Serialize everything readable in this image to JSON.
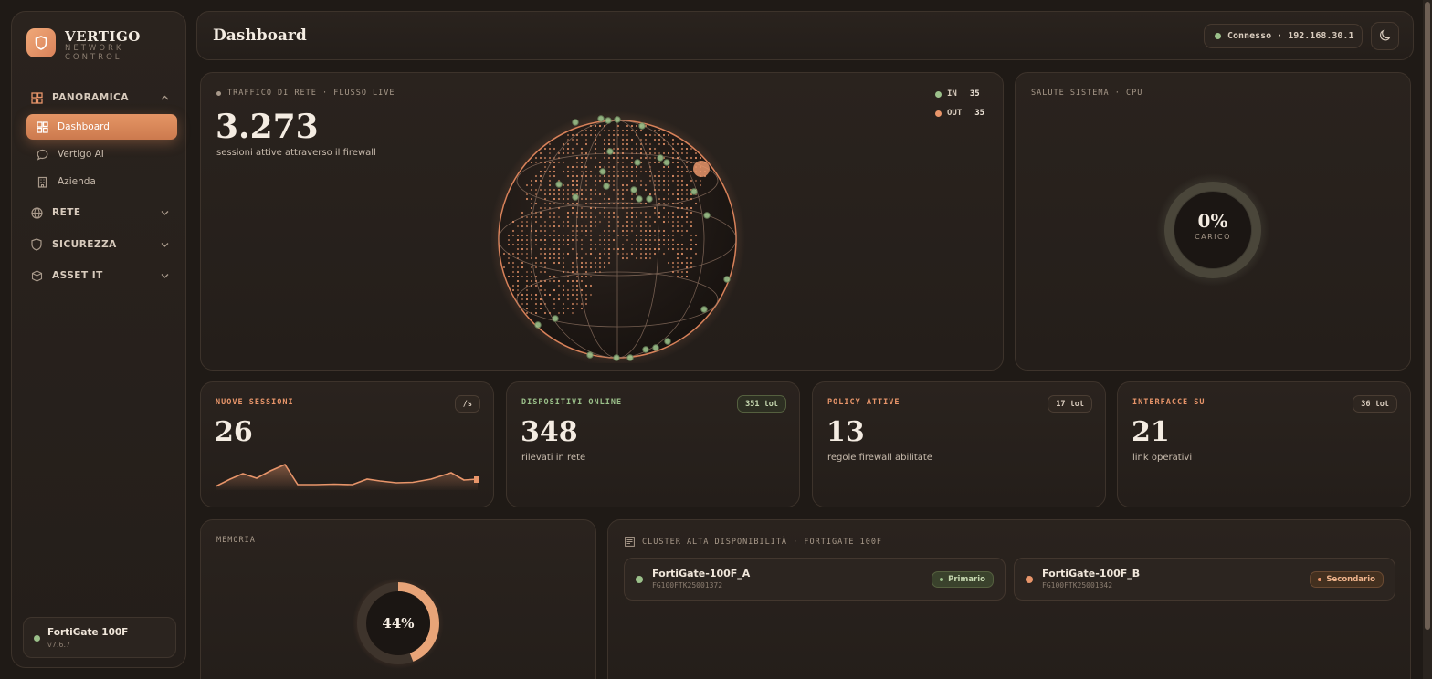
{
  "brand": {
    "name": "VERTIGO",
    "sub": "NETWORK CONTROL"
  },
  "sidebar": {
    "sections": [
      {
        "label": "PANORAMICA",
        "icon": "grid-icon",
        "expanded": true
      },
      {
        "label": "RETE",
        "icon": "globe-icon",
        "expanded": false
      },
      {
        "label": "SICUREZZA",
        "icon": "shield-icon",
        "expanded": false
      },
      {
        "label": "ASSET IT",
        "icon": "box-icon",
        "expanded": false
      }
    ],
    "items": [
      {
        "label": "Dashboard",
        "icon": "dashboard-icon",
        "active": true
      },
      {
        "label": "Vertigo AI",
        "icon": "chat-icon",
        "active": false
      },
      {
        "label": "Azienda",
        "icon": "building-icon",
        "active": false
      }
    ],
    "device": {
      "name": "FortiGate 100F",
      "version": "v7.6.7",
      "status_color": "#9bc08a"
    }
  },
  "header": {
    "title": "Dashboard",
    "connection": "Connesso · 192.168.30.1",
    "theme_icon": "moon-icon"
  },
  "traffic": {
    "label": "TRAFFICO DI RETE · FLUSSO LIVE",
    "value": "3.273",
    "desc": "sessioni attive attraverso il firewall",
    "legend": [
      {
        "label": "IN",
        "value": "35",
        "color": "#9bc08a"
      },
      {
        "label": "OUT",
        "value": "35",
        "color": "#e8956a"
      }
    ]
  },
  "cpu": {
    "label": "SALUTE SISTEMA · CPU",
    "value": "0%",
    "sublabel": "CARICO",
    "load_fraction": 0
  },
  "stats": [
    {
      "title": "NUOVE SESSIONI",
      "badge": "/s",
      "value": "26",
      "desc": "",
      "color": "#e8956a"
    },
    {
      "title": "DISPOSITIVI ONLINE",
      "badge": "351 tot",
      "value": "348",
      "desc": "rilevati in rete",
      "color": "#9bc08a"
    },
    {
      "title": "POLICY ATTIVE",
      "badge": "17 tot",
      "value": "13",
      "desc": "regole firewall abilitate",
      "color": "#e8956a"
    },
    {
      "title": "INTERFACCE SU",
      "badge": "36 tot",
      "value": "21",
      "desc": "link operativi",
      "color": "#e8956a"
    }
  ],
  "memory": {
    "label": "MEMORIA",
    "value": "44%",
    "fraction": 0.44
  },
  "cluster": {
    "label": "CLUSTER ALTA DISPONIBILITÀ · FORTIGATE 100F",
    "nodes": [
      {
        "name": "FortiGate-100F_A",
        "serial": "FG100FTK25001372",
        "role": "Primario",
        "color": "#9bc08a"
      },
      {
        "name": "FortiGate-100F_B",
        "serial": "FG100FTK25001342",
        "role": "Secondario",
        "color": "#e8956a"
      }
    ]
  }
}
